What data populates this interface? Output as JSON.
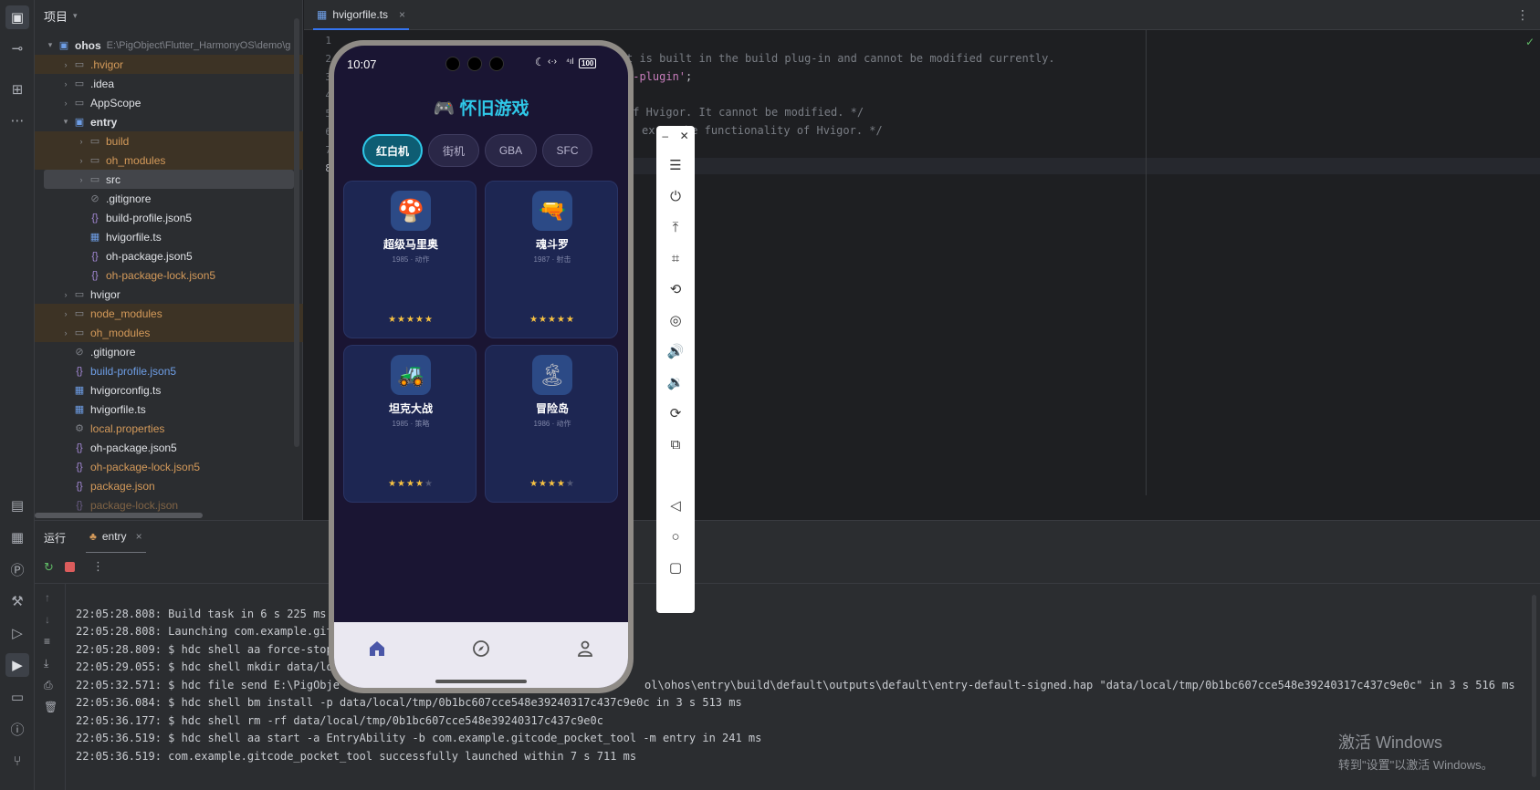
{
  "project": {
    "panel_title": "项目",
    "root_name": "ohos",
    "root_path": "E:\\PigObject\\Flutter_HarmonyOS\\demo\\g",
    "tree": [
      {
        "label": ".hvigor"
      },
      {
        "label": ".idea"
      },
      {
        "label": "AppScope"
      },
      {
        "label": "entry"
      },
      {
        "label": "build"
      },
      {
        "label": "oh_modules"
      },
      {
        "label": "src"
      },
      {
        "label": ".gitignore"
      },
      {
        "label": "build-profile.json5"
      },
      {
        "label": "hvigorfile.ts"
      },
      {
        "label": "oh-package.json5"
      },
      {
        "label": "oh-package-lock.json5"
      },
      {
        "label": "hvigor"
      },
      {
        "label": "node_modules"
      },
      {
        "label": "oh_modules"
      },
      {
        "label": ".gitignore"
      },
      {
        "label": "build-profile.json5"
      },
      {
        "label": "hvigorconfig.ts"
      },
      {
        "label": "hvigorfile.ts"
      },
      {
        "label": "local.properties"
      },
      {
        "label": "oh-package.json5"
      },
      {
        "label": "oh-package-lock.json5"
      },
      {
        "label": "package.json"
      },
      {
        "label": "package-lock.json"
      }
    ]
  },
  "editor": {
    "tab_label": "hvigorfile.ts",
    "line_numbers": [
      "1",
      "2",
      "3",
      "4",
      "5",
      "6",
      "7",
      "8"
    ],
    "code_fragments": [
      "t is built in the build plug-in and cannot be modified currently.",
      "s-plugin'",
      ";",
      "of Hvigor. It cannot be modified. */",
      "ex",
      "he functionality of Hvigor. */"
    ]
  },
  "run": {
    "tab_run": "运行",
    "tab_entry": "entry",
    "lines": [
      "22:05:28.808: Build task in 6 s 225 ms",
      "22:05:28.808: Launching com.example.git",
      "22:05:28.809: $ hdc shell aa force-stop",
      "22:05:29.055: $ hdc shell mkdir data/lo",
      "22:05:32.571: $ hdc file send E:\\PigObje",
      "22:05:36.084: $ hdc shell bm install -p data/local/tmp/0b1bc607cce548e39240317c437c9e0c in 3 s 513 ms",
      "22:05:36.177: $ hdc shell rm -rf data/local/tmp/0b1bc607cce548e39240317c437c9e0c",
      "22:05:36.519: $ hdc shell aa start -a EntryAbility -b com.example.gitcode_pocket_tool -m entry in 241 ms",
      "22:05:36.519: com.example.gitcode_pocket_tool successfully launched within 7 s 711 ms"
    ],
    "line5_tail": "ol\\ohos\\entry\\build\\default\\outputs\\default\\entry-default-signed.hap \"data/local/tmp/0b1bc607cce548e39240317c437c9e0c\" in 3 s 516 ms"
  },
  "watermark": {
    "line1": "激活 Windows",
    "line2": "转到\"设置\"以激活 Windows。"
  },
  "phone": {
    "time": "10:07",
    "battery": "100",
    "title": "🎮 怀旧游戏",
    "categories": [
      "红白机",
      "街机",
      "GBA",
      "SFC"
    ],
    "selected_category": "红白机",
    "games": [
      {
        "icon": "🍄",
        "name": "超级马里奥",
        "meta": "1985 · 动作",
        "rating": 5
      },
      {
        "icon": "🔫",
        "name": "魂斗罗",
        "meta": "1987 · 射击",
        "rating": 5
      },
      {
        "icon": "🚜",
        "name": "坦克大战",
        "meta": "1985 · 策略",
        "rating": 4
      },
      {
        "icon": "🏝",
        "name": "冒险岛",
        "meta": "1986 · 动作",
        "rating": 4
      }
    ],
    "bottom_tabs": [
      "home-icon",
      "compass-icon",
      "person-icon"
    ]
  },
  "colors": {
    "accent": "#2fc8e8",
    "phone_bg": "#1a1533",
    "card_bg": "#1d2652",
    "star": "#f7c242"
  }
}
